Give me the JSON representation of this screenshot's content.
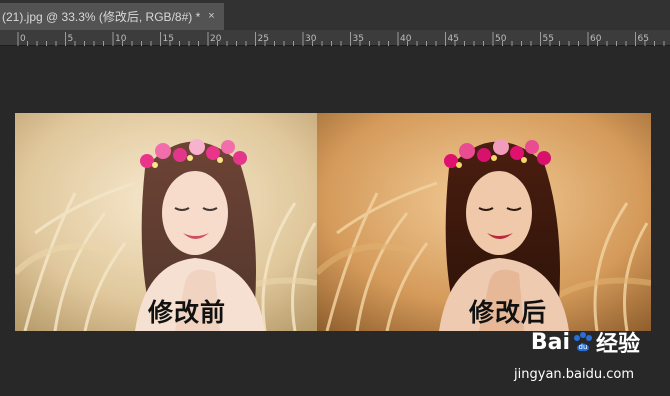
{
  "tab": {
    "title": "(21).jpg @ 33.3% (修改后, RGB/8#) *",
    "close_glyph": "×"
  },
  "ruler": {
    "labels": [
      "0",
      "5",
      "10",
      "15",
      "20",
      "25",
      "30",
      "35",
      "40",
      "45",
      "50",
      "55",
      "60",
      "65"
    ]
  },
  "photos": {
    "before_caption": "修改前",
    "after_caption": "修改后"
  },
  "watermark": {
    "brand_prefix": "Bai",
    "brand_suffix": "经验",
    "url": "jingyan.baidu.com"
  },
  "colors": {
    "background": "#282828",
    "tab_active": "#535353",
    "ruler": "#3c3c3c",
    "watermark_blue": "#2a6fd8"
  }
}
